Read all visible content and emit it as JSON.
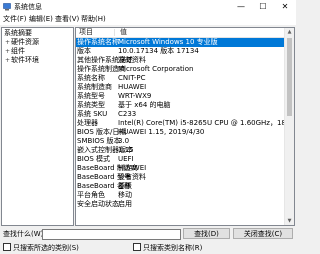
{
  "window": {
    "title": "系统信息",
    "icon": "system-info-icon",
    "controls": [
      "minimize-icon",
      "maximize-icon",
      "close-icon"
    ]
  },
  "menu": [
    "文件(F)",
    "编辑(E)",
    "查看(V)",
    "帮助(H)"
  ],
  "tree": [
    {
      "label": "系统摘要",
      "expander": ""
    },
    {
      "label": "硬件资源",
      "expander": "+"
    },
    {
      "label": "组件",
      "expander": "+"
    },
    {
      "label": "软件环境",
      "expander": "+"
    }
  ],
  "table": {
    "columns": [
      "项目",
      "值"
    ],
    "rows": [
      {
        "item": "操作系统名称",
        "value": "Microsoft Windows 10 专业版",
        "selected": true
      },
      {
        "item": "版本",
        "value": "10.0.17134 版本 17134"
      },
      {
        "item": "其他操作系统描述",
        "value": "没有资料"
      },
      {
        "item": "操作系统制造商",
        "value": "Microsoft Corporation"
      },
      {
        "item": "系统名称",
        "value": "CNIT-PC"
      },
      {
        "item": "系统制造商",
        "value": "HUAWEI"
      },
      {
        "item": "系统型号",
        "value": "WRT-WX9"
      },
      {
        "item": "系统类型",
        "value": "基于 x64 的电脑"
      },
      {
        "item": "系统 SKU",
        "value": "C233"
      },
      {
        "item": "处理器",
        "value": "Intel(R) Core(TM) i5-8265U CPU @ 1.60GHz，1800 ..."
      },
      {
        "item": "BIOS 版本/日期",
        "value": "HUAWEI 1.15, 2019/4/30"
      },
      {
        "item": "SMBIOS 版本",
        "value": "3.0"
      },
      {
        "item": "嵌入式控制器版本",
        "value": "1.15"
      },
      {
        "item": "BIOS 模式",
        "value": "UEFI"
      },
      {
        "item": "BaseBoard 制造商",
        "value": "HUAWEI"
      },
      {
        "item": "BaseBoard 型号",
        "value": "没有资料"
      },
      {
        "item": "BaseBoard 名称",
        "value": "基板"
      },
      {
        "item": "平台角色",
        "value": "移动"
      },
      {
        "item": "安全启动状态",
        "value": "启用"
      }
    ]
  },
  "find": {
    "label": "查找什么(W):",
    "value": "",
    "find_button": "查找(D)",
    "close_button": "关闭查找(C)",
    "check_selected_only": "只搜索所选的类别(S)",
    "check_names_only": "只搜索类别名称(R)"
  },
  "colors": {
    "selection": "#0078d7",
    "window_bg": "#f0f0f0"
  }
}
